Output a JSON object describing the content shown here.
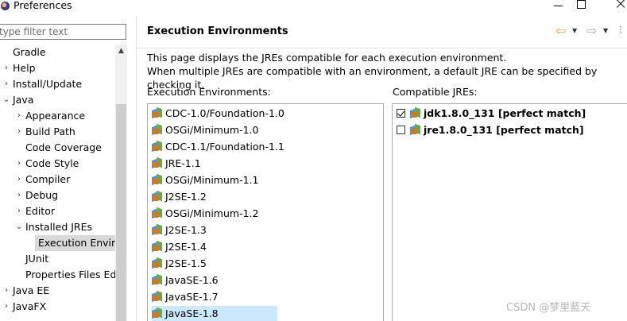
{
  "window": {
    "title": "Preferences"
  },
  "filter": {
    "placeholder": "type filter text"
  },
  "tree": {
    "items": [
      {
        "label": "Gradle",
        "expander": "",
        "level": 0
      },
      {
        "label": "Help",
        "expander": "›",
        "level": 0
      },
      {
        "label": "Install/Update",
        "expander": "›",
        "level": 0
      },
      {
        "label": "Java",
        "expander": "⌄",
        "level": 0
      },
      {
        "label": "Appearance",
        "expander": "›",
        "level": 1
      },
      {
        "label": "Build Path",
        "expander": "›",
        "level": 1
      },
      {
        "label": "Code Coverage",
        "expander": "",
        "level": 1
      },
      {
        "label": "Code Style",
        "expander": "›",
        "level": 1
      },
      {
        "label": "Compiler",
        "expander": "›",
        "level": 1
      },
      {
        "label": "Debug",
        "expander": "›",
        "level": 1
      },
      {
        "label": "Editor",
        "expander": "›",
        "level": 1
      },
      {
        "label": "Installed JREs",
        "expander": "⌄",
        "level": 1
      },
      {
        "label": "Execution Enviro",
        "expander": "",
        "level": 2,
        "selected": true
      },
      {
        "label": "JUnit",
        "expander": "",
        "level": 1
      },
      {
        "label": "Properties Files Edi",
        "expander": "",
        "level": 1
      },
      {
        "label": "Java EE",
        "expander": "›",
        "level": 0
      },
      {
        "label": "JavaFX",
        "expander": "›",
        "level": 0
      }
    ]
  },
  "page": {
    "title": "Execution Environments",
    "description_line1": "This page displays the JREs compatible for each execution environment.",
    "description_line2": "When multiple JREs are compatible with an environment, a default JRE can be specified by checking it."
  },
  "environments": {
    "label": "Execution Environments:",
    "items": [
      "CDC-1.0/Foundation-1.0",
      "OSGi/Minimum-1.0",
      "CDC-1.1/Foundation-1.1",
      "JRE-1.1",
      "OSGi/Minimum-1.1",
      "J2SE-1.2",
      "OSGi/Minimum-1.2",
      "J2SE-1.3",
      "J2SE-1.4",
      "J2SE-1.5",
      "JavaSE-1.6",
      "JavaSE-1.7",
      "JavaSE-1.8"
    ],
    "selected": "JavaSE-1.8"
  },
  "compatible_jres": {
    "label": "Compatible JREs:",
    "items": [
      {
        "label": "jdk1.8.0_131 [perfect match]",
        "checked": true
      },
      {
        "label": "jre1.8.0_131 [perfect match]",
        "checked": false
      }
    ]
  },
  "watermark": "CSDN @梦里藍天"
}
